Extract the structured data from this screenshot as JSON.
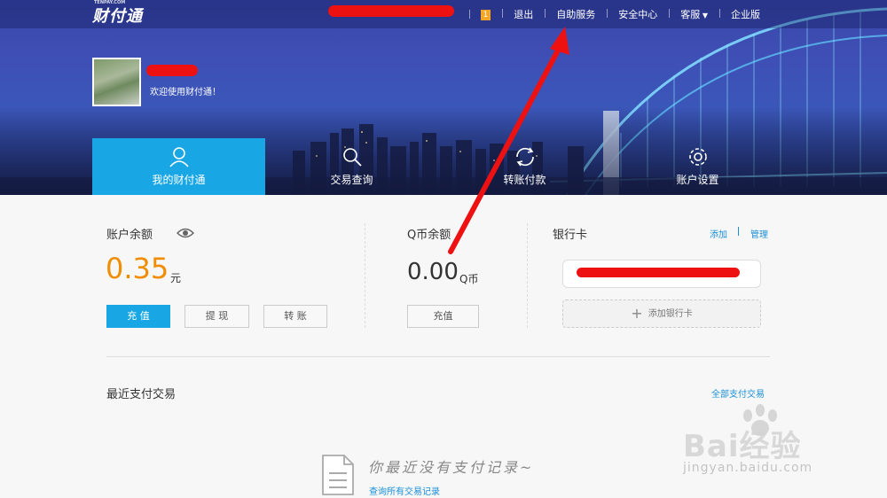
{
  "brand": {
    "logo_text": "财付通",
    "logo_small": "TENPAY.COM"
  },
  "topnav": {
    "badge": "1",
    "logout": "退出",
    "self_service": "自助服务",
    "security": "安全中心",
    "customer_service": "客服",
    "enterprise": "企业版"
  },
  "user": {
    "welcome": "欢迎使用财付通！"
  },
  "tabs": [
    {
      "label": "我的财付通",
      "icon": "user-icon"
    },
    {
      "label": "交易查询",
      "icon": "search-icon"
    },
    {
      "label": "转账付款",
      "icon": "refresh-icon"
    },
    {
      "label": "账户设置",
      "icon": "gear-icon"
    }
  ],
  "account": {
    "title": "账户余额",
    "balance": "0.35",
    "unit": "元",
    "recharge": "充 值",
    "withdraw": "提 现",
    "transfer": "转 账"
  },
  "qcoin": {
    "title": "Q币余额",
    "balance": "0.00",
    "unit": "Q币",
    "recharge": "充值"
  },
  "bank": {
    "title": "银行卡",
    "add": "添加",
    "manage": "管理",
    "add_card": "添加银行卡"
  },
  "recent": {
    "title": "最近支付交易",
    "all_link": "全部支付交易",
    "empty_text": "你最近没有支付记录~",
    "query_link": "查询所有交易记录"
  },
  "watermark": {
    "text": "Bai经验",
    "url": "jingyan.baidu.com"
  },
  "colors": {
    "accent": "#19a6e5",
    "balance": "#f08d00",
    "link": "#1a8fd8",
    "annotation": "#ee1111"
  }
}
